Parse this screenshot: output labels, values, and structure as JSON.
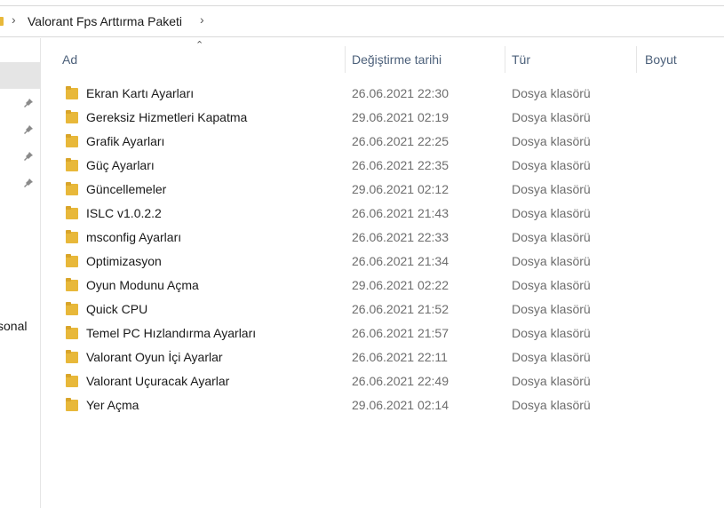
{
  "breadcrumb": {
    "path_label": "Valorant Fps Arttırma Paketi"
  },
  "nav": {
    "partial_label": "sonal"
  },
  "columns": {
    "name": "Ad",
    "date": "Değiştirme tarihi",
    "type": "Tür",
    "size": "Boyut"
  },
  "files": [
    {
      "name": "Ekran Kartı Ayarları",
      "date": "26.06.2021 22:30",
      "type": "Dosya klasörü"
    },
    {
      "name": "Gereksiz Hizmetleri Kapatma",
      "date": "29.06.2021 02:19",
      "type": "Dosya klasörü"
    },
    {
      "name": "Grafik Ayarları",
      "date": "26.06.2021 22:25",
      "type": "Dosya klasörü"
    },
    {
      "name": "Güç Ayarları",
      "date": "26.06.2021 22:35",
      "type": "Dosya klasörü"
    },
    {
      "name": "Güncellemeler",
      "date": "29.06.2021 02:12",
      "type": "Dosya klasörü"
    },
    {
      "name": "ISLC v1.0.2.2",
      "date": "26.06.2021 21:43",
      "type": "Dosya klasörü"
    },
    {
      "name": "msconfig Ayarları",
      "date": "26.06.2021 22:33",
      "type": "Dosya klasörü"
    },
    {
      "name": "Optimizasyon",
      "date": "26.06.2021 21:34",
      "type": "Dosya klasörü"
    },
    {
      "name": "Oyun Modunu Açma",
      "date": "29.06.2021 02:22",
      "type": "Dosya klasörü"
    },
    {
      "name": "Quick CPU",
      "date": "26.06.2021 21:52",
      "type": "Dosya klasörü"
    },
    {
      "name": "Temel PC Hızlandırma Ayarları",
      "date": "26.06.2021 21:57",
      "type": "Dosya klasörü"
    },
    {
      "name": "Valorant Oyun İçi Ayarlar",
      "date": "26.06.2021 22:11",
      "type": "Dosya klasörü"
    },
    {
      "name": "Valorant Uçuracak Ayarlar",
      "date": "26.06.2021 22:49",
      "type": "Dosya klasörü"
    },
    {
      "name": "Yer Açma",
      "date": "29.06.2021 02:14",
      "type": "Dosya klasörü"
    }
  ],
  "colors": {
    "folder": "#e8b83a",
    "folder_dark": "#d9a52a",
    "header_text": "#4c607a"
  }
}
